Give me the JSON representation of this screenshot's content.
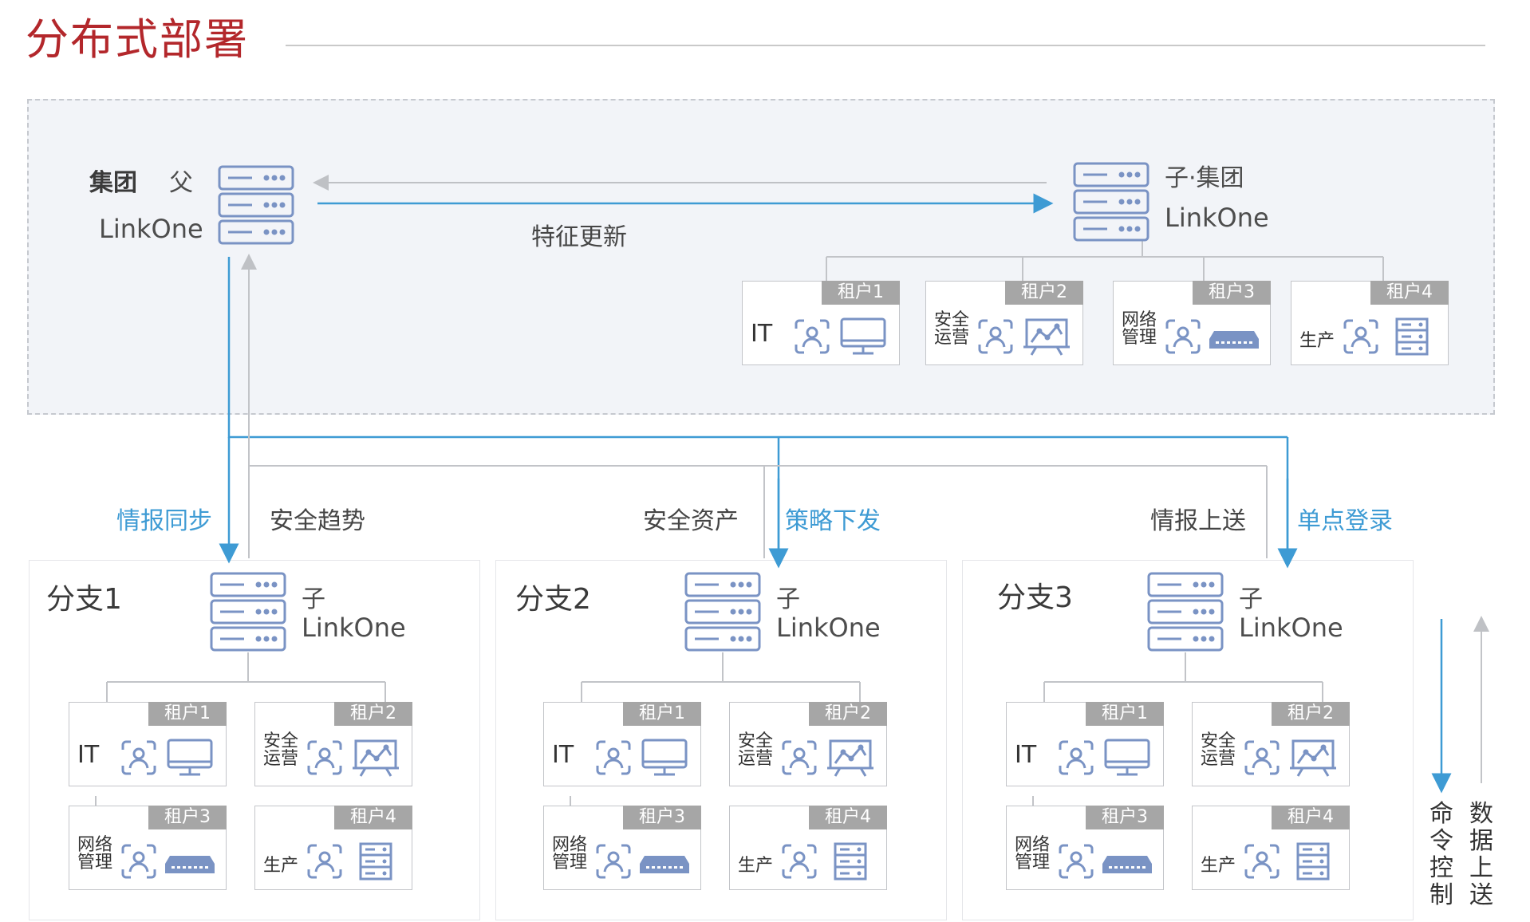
{
  "page_title": "分布式部署",
  "group": {
    "label": "集团",
    "role": "父",
    "product": "LinkOne"
  },
  "sub_group": {
    "role": "子·集团",
    "product": "LinkOne"
  },
  "flows": {
    "feature_update": "特征更新",
    "intel_sync": "情报同步",
    "security_trend": "安全趋势",
    "security_assets": "安全资产",
    "policy_push": "策略下发",
    "intel_upload": "情报上送",
    "sso": "单点登录"
  },
  "tenants": {
    "t1": {
      "tag": "租户1",
      "name": "IT",
      "device": "monitor-icon"
    },
    "t2": {
      "tag": "租户2",
      "name": "安全运营",
      "device": "presentation-board-icon"
    },
    "t3": {
      "tag": "租户3",
      "name": "网络管理",
      "device": "network-switch-icon"
    },
    "t4": {
      "tag": "租户4",
      "name": "生产",
      "device": "server-rack-icon"
    }
  },
  "branches": [
    {
      "title": "分支1",
      "role": "子",
      "product": "LinkOne"
    },
    {
      "title": "分支2",
      "role": "子",
      "product": "LinkOne"
    },
    {
      "title": "分支3",
      "role": "子",
      "product": "LinkOne"
    }
  ],
  "legend": {
    "command": "命令控制",
    "data": "数据上送"
  },
  "colors": {
    "title": "#b3272b",
    "blue_line": "#3e9bd4",
    "gray_line": "#c2c4c8",
    "icon": "#7a93c4"
  }
}
